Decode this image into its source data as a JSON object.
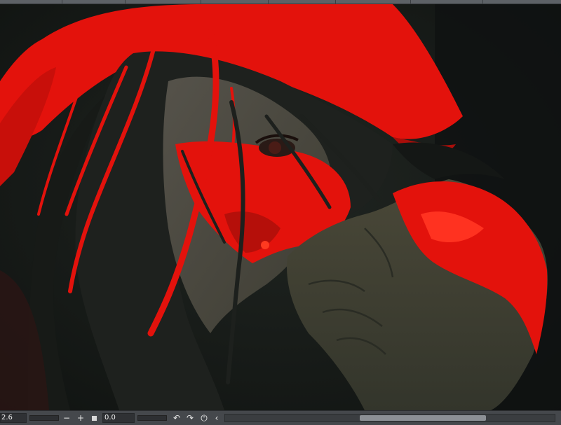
{
  "status_bar": {
    "zoom_value": "2.6",
    "zoom_out_symbol": "−",
    "zoom_in_symbol": "+",
    "angle_value": "0.0",
    "rotate_left_symbol": "↶",
    "rotate_right_symbol": "↷",
    "reset_rotation_symbol": "⏻",
    "flip_symbol": "‹"
  },
  "icons": {
    "zoom_out": "minus-icon",
    "zoom_in": "plus-icon",
    "fit": "square-icon",
    "rotate_left": "rotate-left-icon",
    "rotate_right": "rotate-right-icon",
    "reset_rotation": "reset-rotation-icon",
    "flip": "chevron-left-icon"
  },
  "colors": {
    "chrome": "#45484c",
    "accent_red": "#e3120c",
    "shadow": "#151816",
    "skin_shadow": "#4d4a3e"
  },
  "h_scrollbar": {
    "thumb_position": 0.5
  }
}
